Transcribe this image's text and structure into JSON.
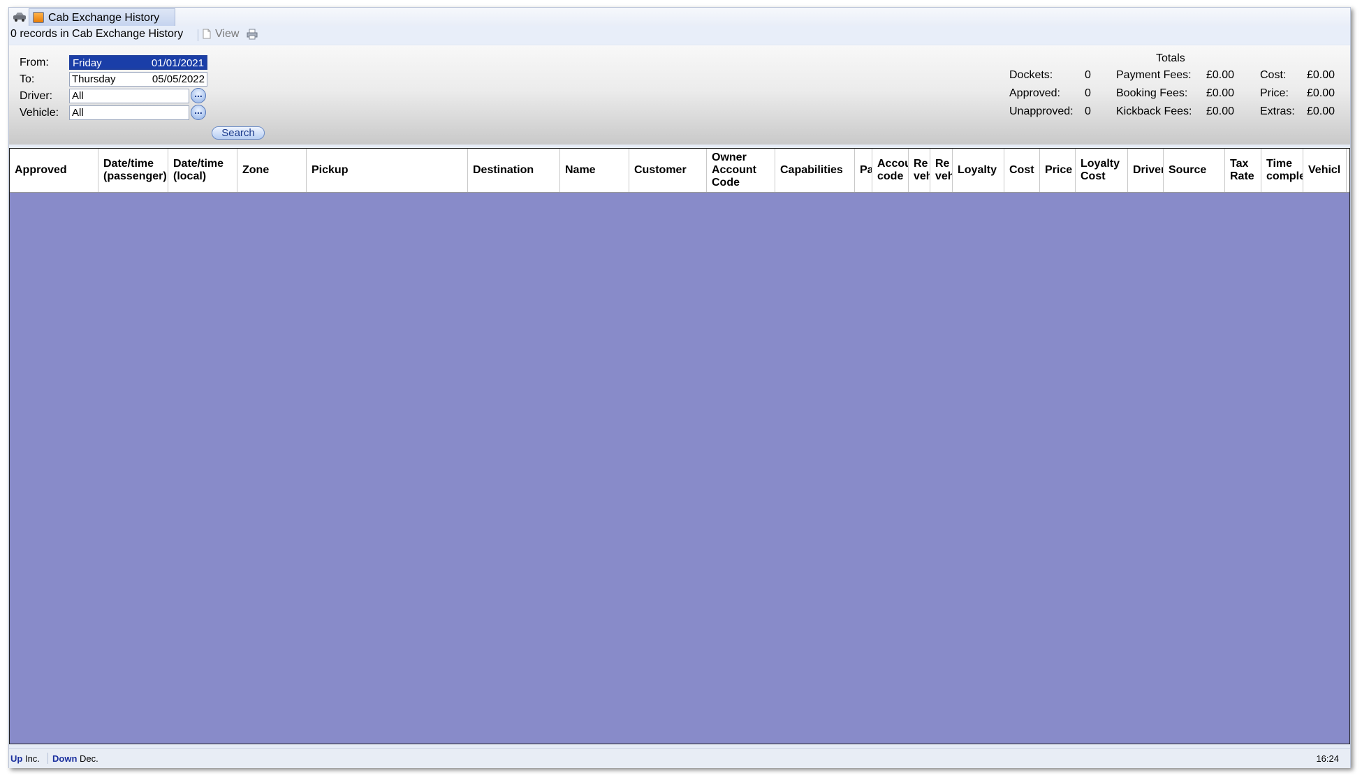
{
  "tab": {
    "title": "Cab Exchange History"
  },
  "toolbar": {
    "record_count": "0 records in Cab Exchange History",
    "view_label": "View"
  },
  "filters": {
    "from_label": "From:",
    "from_day": "Friday",
    "from_date": "01/01/2021",
    "to_label": "To:",
    "to_day": "Thursday",
    "to_date": "05/05/2022",
    "driver_label": "Driver:",
    "driver_value": "All",
    "vehicle_label": "Vehicle:",
    "vehicle_value": "All",
    "browse_label": "...",
    "search_label": "Search"
  },
  "totals": {
    "title": "Totals",
    "dockets_label": "Dockets:",
    "dockets_value": "0",
    "approved_label": "Approved:",
    "approved_value": "0",
    "unapproved_label": "Unapproved:",
    "unapproved_value": "0",
    "payment_fees_label": "Payment Fees:",
    "payment_fees_value": "£0.00",
    "booking_fees_label": "Booking Fees:",
    "booking_fees_value": "£0.00",
    "kickback_fees_label": "Kickback Fees:",
    "kickback_fees_value": "£0.00",
    "cost_label": "Cost:",
    "cost_value": "£0.00",
    "price_label": "Price:",
    "price_value": "£0.00",
    "extras_label": "Extras:",
    "extras_value": "£0.00"
  },
  "grid": {
    "columns": [
      "Approved",
      "Date/time\n(passenger)",
      "Date/time\n(local)",
      "Zone",
      "Pickup",
      "Destination",
      "Name",
      "Customer",
      "Owner\nAccount\nCode",
      "Capabilities",
      "Pa",
      "Accou\ncode",
      "Re\nveh",
      "Re\nveh",
      "Loyalty",
      "Cost",
      "Price",
      "Loyalty\nCost",
      "Driver",
      "Source",
      "Tax\nRate",
      "Time\ncomplet",
      "Vehicl"
    ]
  },
  "statusbar": {
    "up_key": "Up",
    "up_text": "Inc.",
    "down_key": "Down",
    "down_text": "Dec.",
    "time": "16:24"
  },
  "colors": {
    "grid_background": "#888bc9",
    "selection": "#1a3ea8",
    "status_key": "#1a2f9e"
  }
}
